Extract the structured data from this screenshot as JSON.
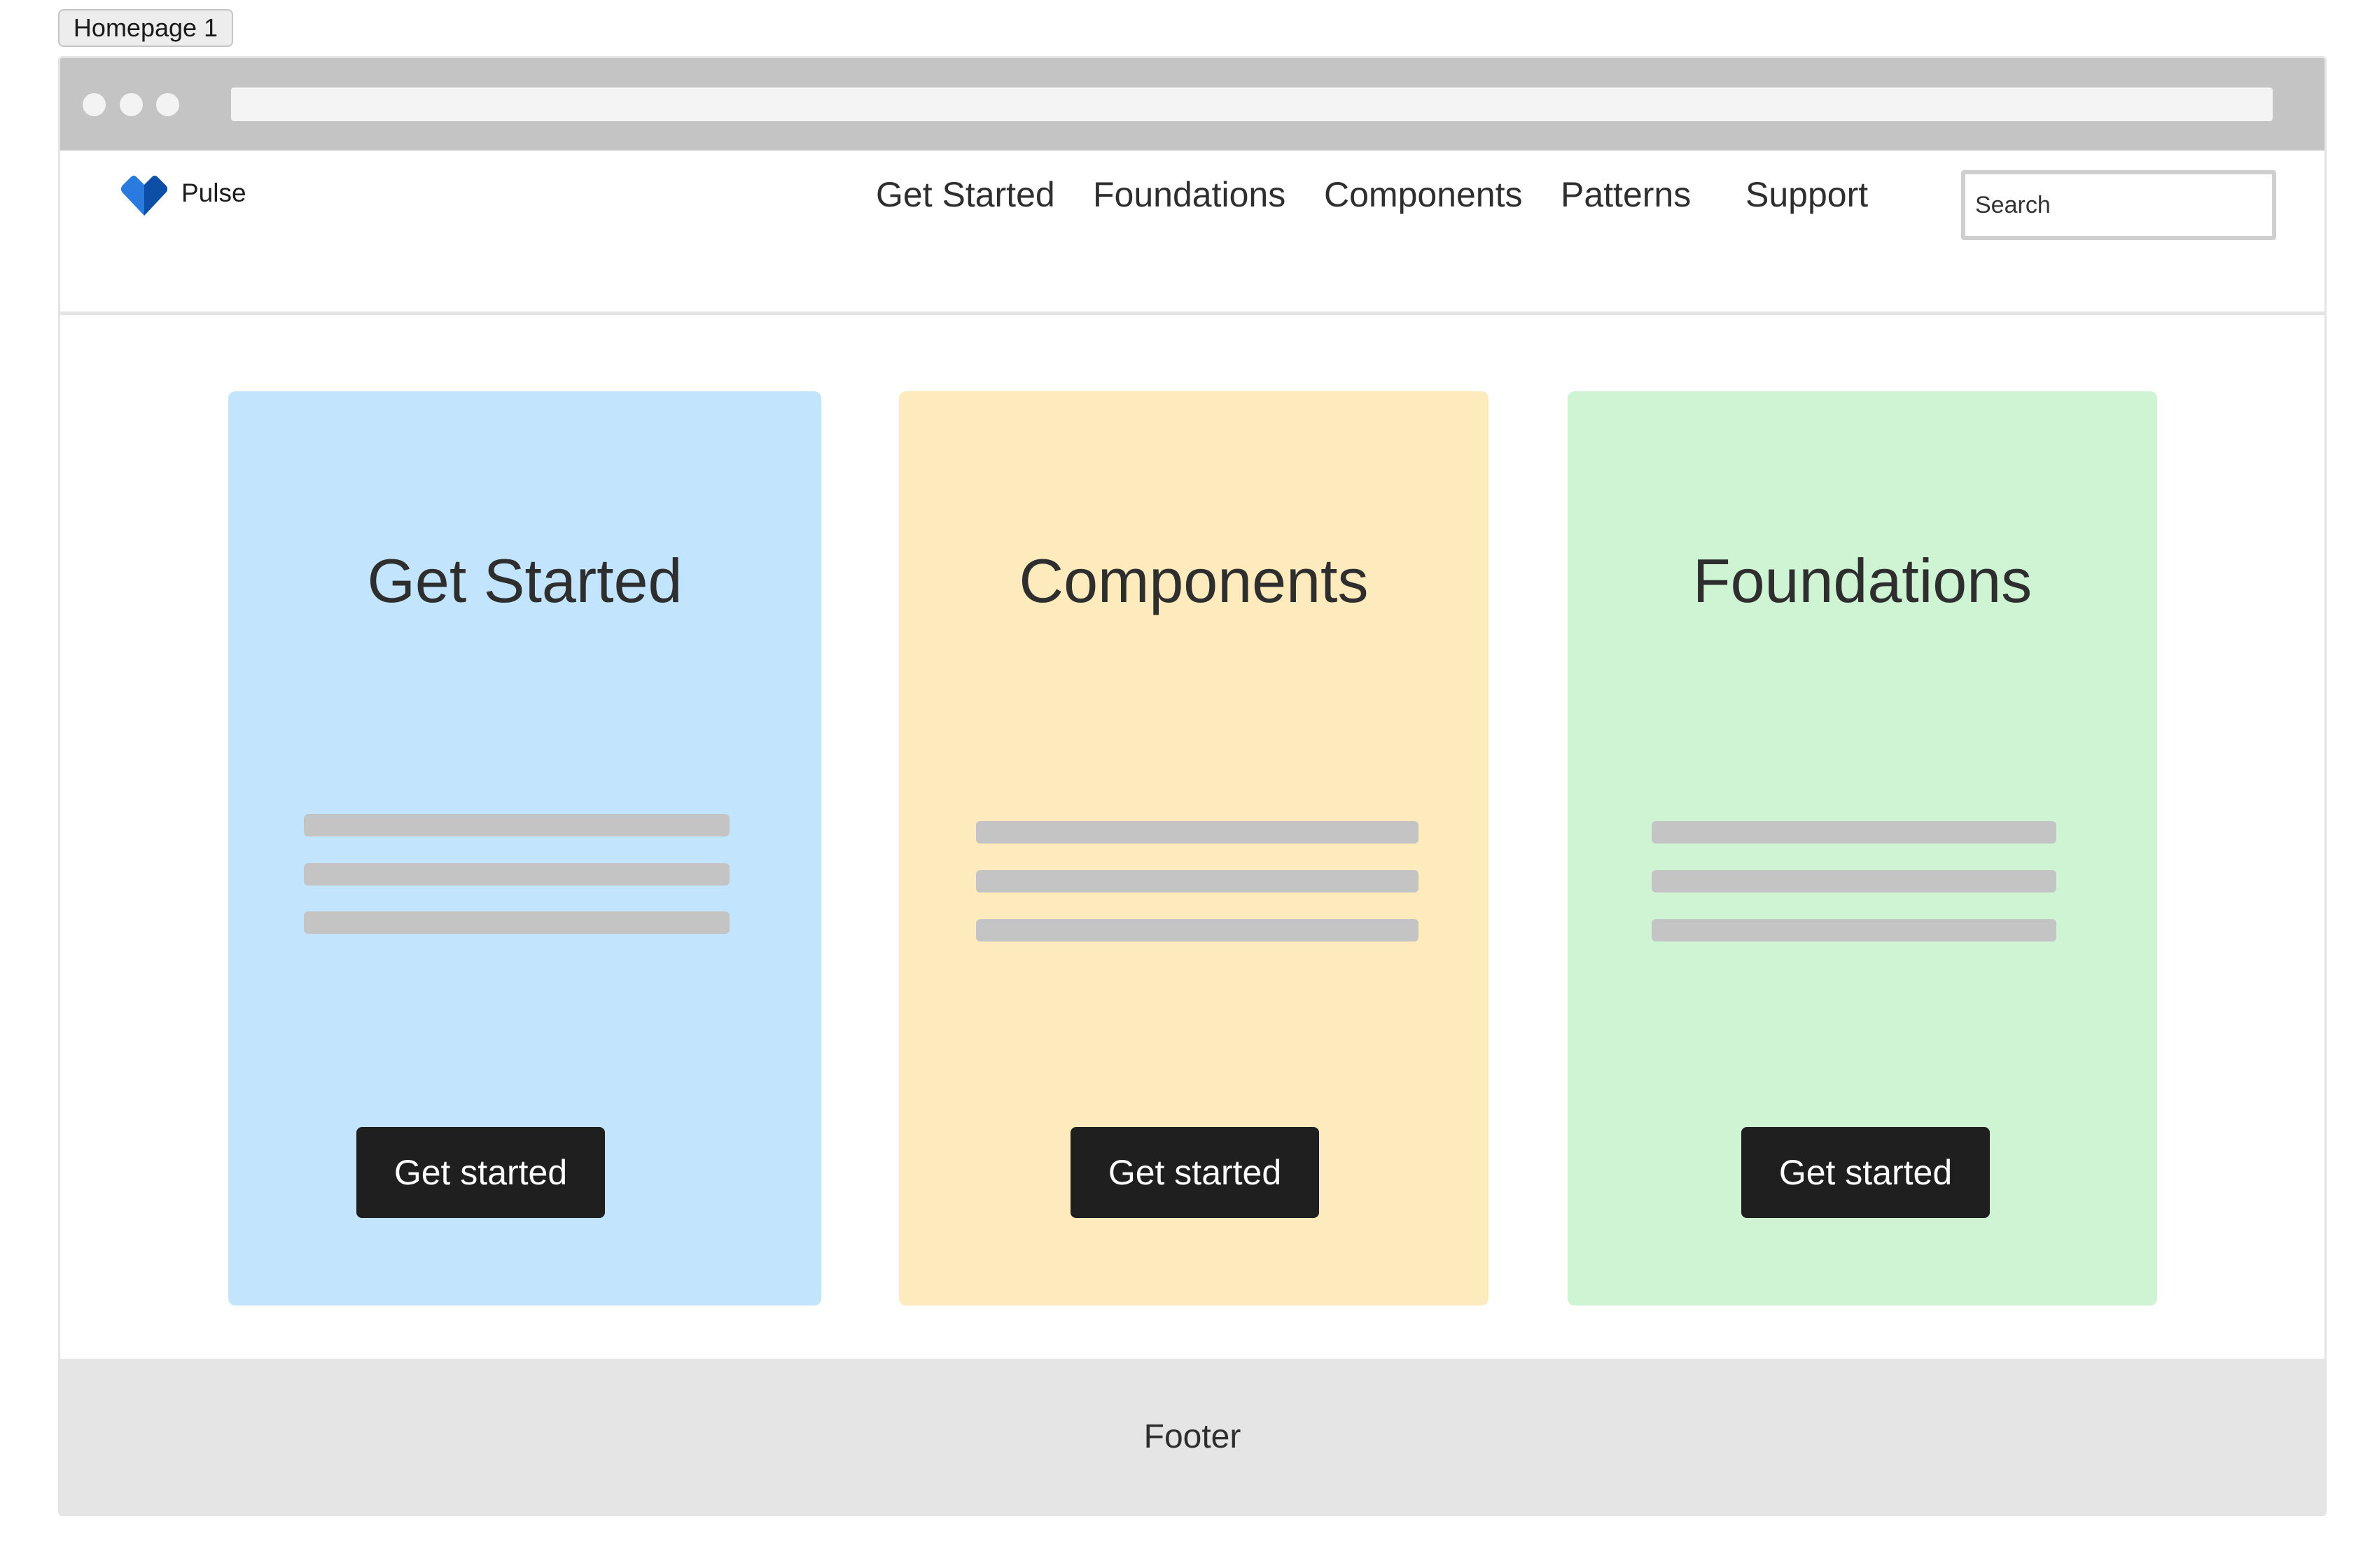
{
  "frame": {
    "label": "Homepage 1"
  },
  "header": {
    "brand": "Pulse",
    "nav": [
      "Get Started",
      "Foundations",
      "Components",
      "Patterns",
      "Support"
    ],
    "search": {
      "placeholder": "Search",
      "value": ""
    }
  },
  "cards": [
    {
      "title": "Get Started",
      "button": "Get started",
      "color": "#c2e5fd"
    },
    {
      "title": "Components",
      "button": "Get started",
      "color": "#fdeabd"
    },
    {
      "title": "Foundations",
      "button": "Get started",
      "color": "#cff4d3"
    }
  ],
  "footer": {
    "label": "Footer"
  },
  "colors": {
    "accent": "#1565c0",
    "button_bg": "#1f1f1f",
    "placeholder_line": "#c4c4c4"
  },
  "icons": {
    "logo": "blue-heart-icon"
  }
}
